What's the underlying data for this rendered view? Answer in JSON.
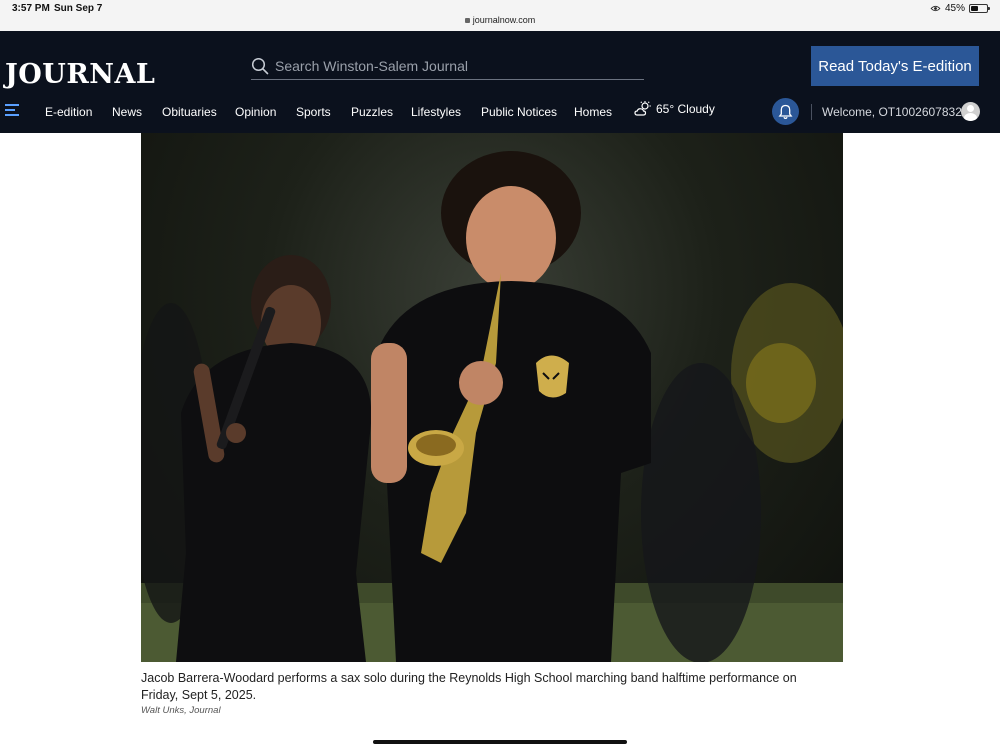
{
  "status_bar": {
    "time": "3:57 PM",
    "date": "Sun Sep 7",
    "url": "journalnow.com",
    "battery": "45%",
    "battery_level": 0.45
  },
  "header": {
    "logo": "JOURNAL",
    "search_placeholder": "Search Winston-Salem Journal",
    "eedition_button": "Read Today's E-edition"
  },
  "nav": {
    "items": [
      "E-edition",
      "News",
      "Obituaries",
      "Opinion",
      "Sports",
      "Puzzles",
      "Lifestyles",
      "Public Notices",
      "Homes"
    ],
    "weather": "65° Cloudy",
    "welcome": "Welcome, OT10026078322"
  },
  "article": {
    "caption": "Jacob Barrera-Woodard performs a sax solo during the Reynolds High School marching band halftime performance on Friday, Sept 5, 2025.",
    "credit": "Walt Unks, Journal"
  },
  "colors": {
    "header_bg": "#0b111d",
    "accent": "#2b5797",
    "menu_icon": "#5aa0ff"
  }
}
